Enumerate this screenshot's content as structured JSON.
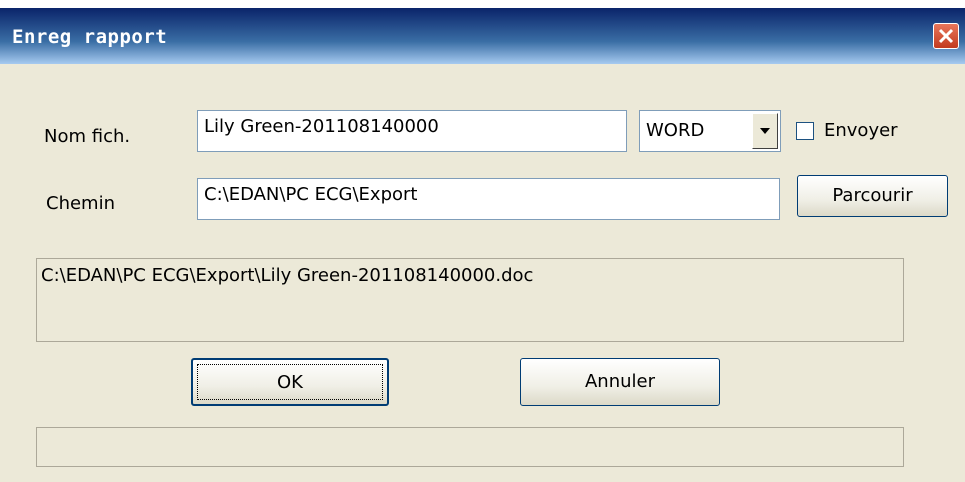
{
  "dialog": {
    "title": "Enreg rapport",
    "close_icon": "close-icon"
  },
  "form": {
    "filename_label": "Nom fich.",
    "filename_value": "Lily Green-201108140000",
    "format_selected": "WORD",
    "send_label": "Envoyer",
    "send_checked": false,
    "path_label": "Chemin",
    "path_value": "C:\\EDAN\\PC ECG\\Export",
    "browse_label": "Parcourir"
  },
  "preview": {
    "full_path": "C:\\EDAN\\PC ECG\\Export\\Lily Green-201108140000.doc"
  },
  "actions": {
    "ok_label": "OK",
    "cancel_label": "Annuler"
  },
  "status": {
    "text": ""
  },
  "colors": {
    "dialog_bg": "#ece9d8",
    "titlebar_dark": "#0a246a",
    "titlebar_light": "#a6caf0",
    "close_red": "#c23a1f"
  }
}
